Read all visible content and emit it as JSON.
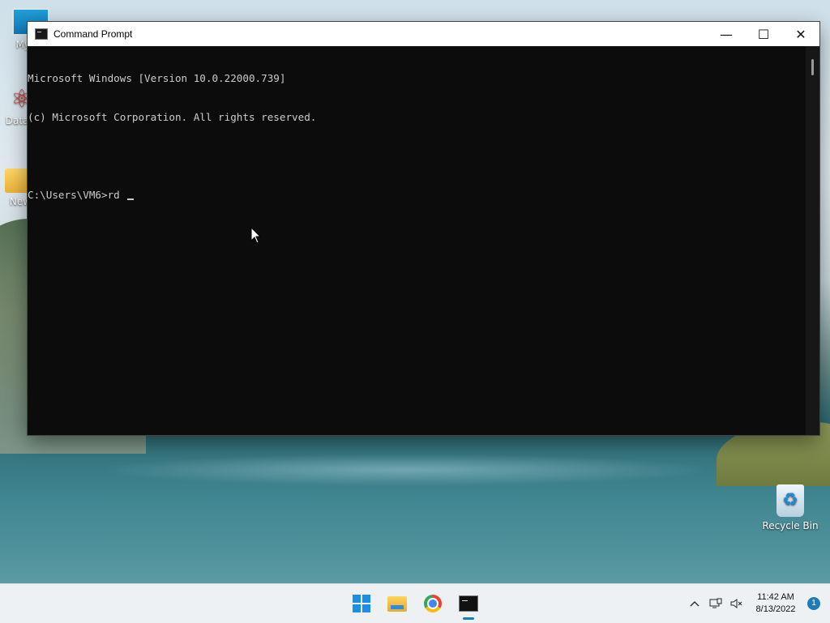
{
  "desktop": {
    "icons": [
      {
        "label": "My Co",
        "icon": "monitor-icon"
      },
      {
        "label": "DataW",
        "icon": "atom-shortcut-icon"
      },
      {
        "label": "New",
        "icon": "folder-icon"
      },
      {
        "label": "Recycle Bin",
        "icon": "recycle-bin-icon"
      }
    ]
  },
  "window": {
    "title": "Command Prompt",
    "buttons": {
      "minimize": "—",
      "maximize": "☐",
      "close": "✕"
    },
    "console_lines": [
      "Microsoft Windows [Version 10.0.22000.739]",
      "(c) Microsoft Corporation. All rights reserved.",
      "",
      "C:\\Users\\VM6>rd "
    ]
  },
  "taskbar": {
    "apps": [
      {
        "name": "Start",
        "icon": "windows-start-icon"
      },
      {
        "name": "File Explorer",
        "icon": "file-explorer-icon"
      },
      {
        "name": "Google Chrome",
        "icon": "chrome-icon"
      },
      {
        "name": "Command Prompt",
        "icon": "cmd-icon",
        "active": true
      }
    ],
    "tray": {
      "chevron": "^",
      "network": "🖵",
      "volume": "🔇",
      "time": "11:42 AM",
      "date": "8/13/2022",
      "notifications": "1"
    }
  },
  "colors": {
    "console_bg": "#0c0c0c",
    "console_text": "#cccccc",
    "accent": "#1f7ab8"
  }
}
